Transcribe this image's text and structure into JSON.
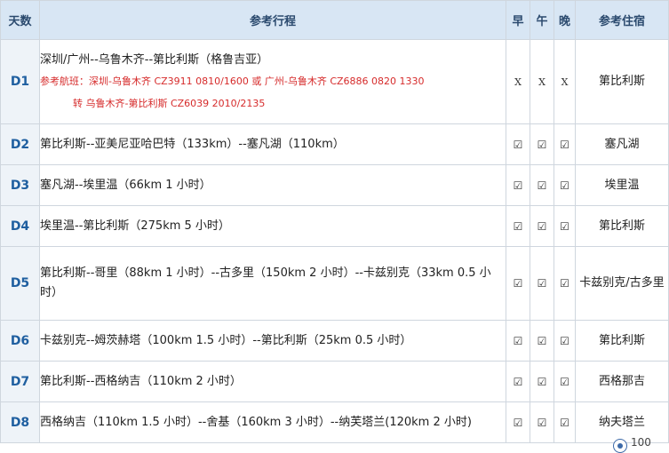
{
  "header": {
    "day": "天数",
    "route": "参考行程",
    "breakfast": "早",
    "lunch": "午",
    "dinner": "晚",
    "hotel": "参考住宿"
  },
  "rows": [
    {
      "day": "D1",
      "route": "深圳/广州--乌鲁木齐--第比利斯（格鲁吉亚）",
      "flight_line1": "参考航班：深圳-乌鲁木齐 CZ3911    0810/1600  或  广州-乌鲁木齐 CZ6886    0820  1330",
      "flight_line2": "转  乌鲁木齐-第比利斯 CZ6039    2010/2135",
      "breakfast": "X",
      "lunch": "X",
      "dinner": "X",
      "hotel": "第比利斯"
    },
    {
      "day": "D2",
      "route": "第比利斯--亚美尼亚哈巴特（133km）--塞凡湖（110km）",
      "breakfast": "☑",
      "lunch": "☑",
      "dinner": "☑",
      "hotel": "塞凡湖"
    },
    {
      "day": "D3",
      "route": "塞凡湖--埃里温（66km 1 小时）",
      "breakfast": "☑",
      "lunch": "☑",
      "dinner": "☑",
      "hotel": "埃里温"
    },
    {
      "day": "D4",
      "route": "埃里温--第比利斯（275km 5 小时）",
      "breakfast": "☑",
      "lunch": "☑",
      "dinner": "☑",
      "hotel": "第比利斯"
    },
    {
      "day": "D5",
      "route": "第比利斯--哥里（88km 1 小时）--古多里（150km 2 小时）--卡兹别克（33km 0.5 小时）",
      "breakfast": "☑",
      "lunch": "☑",
      "dinner": "☑",
      "hotel": "卡兹别克/古多里"
    },
    {
      "day": "D6",
      "route": "卡兹别克--姆茨赫塔（100km 1.5 小时）--第比利斯（25km 0.5 小时）",
      "breakfast": "☑",
      "lunch": "☑",
      "dinner": "☑",
      "hotel": "第比利斯"
    },
    {
      "day": "D7",
      "route": "第比利斯--西格纳吉（110km 2 小时）",
      "breakfast": "☑",
      "lunch": "☑",
      "dinner": "☑",
      "hotel": "西格那吉"
    },
    {
      "day": "D8",
      "route": "西格纳吉（110km 1.5 小时）--舍基（160km 3 小时）--纳芙塔兰(120km 2 小时)",
      "breakfast": "☑",
      "lunch": "☑",
      "dinner": "☑",
      "hotel": "纳夫塔兰"
    }
  ],
  "corner_widget": {
    "text": "100"
  }
}
